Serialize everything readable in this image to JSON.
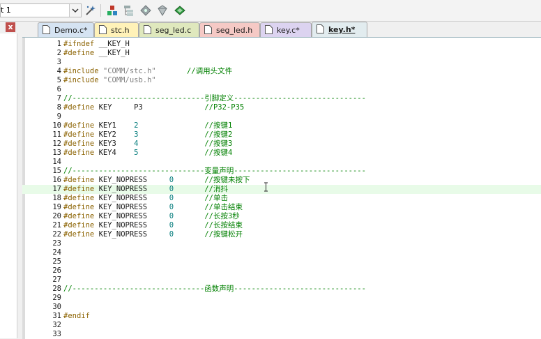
{
  "toolbar": {
    "target_value": "t 1",
    "icons": [
      "dropdown-arrow-icon",
      "magic-wand-icon",
      "component-icon",
      "hierarchy-icon",
      "diamond-icon",
      "options-icon",
      "books-icon"
    ]
  },
  "left_pane": {
    "close_label": "x"
  },
  "tabs": [
    {
      "label": "Demo.c*",
      "color": "#d5e3f2",
      "active": false
    },
    {
      "label": "stc.h",
      "color": "#fff2b8",
      "active": false
    },
    {
      "label": "seg_led.c",
      "color": "#dfe8bd",
      "active": false
    },
    {
      "label": "seg_led.h",
      "color": "#f5c9c5",
      "active": false
    },
    {
      "label": "key.c*",
      "color": "#dcd3f0",
      "active": false
    },
    {
      "label": "key.h*",
      "color": "#e2ecef",
      "active": true
    }
  ],
  "editor": {
    "highlight_line": 17,
    "lines": [
      {
        "n": "1",
        "seg": [
          {
            "c": "kw",
            "t": "#ifndef"
          },
          {
            "c": "",
            "t": " __KEY_H"
          }
        ]
      },
      {
        "n": "2",
        "seg": [
          {
            "c": "kw",
            "t": "#define"
          },
          {
            "c": "",
            "t": " __KEY_H"
          }
        ]
      },
      {
        "n": "3",
        "seg": []
      },
      {
        "n": "4",
        "seg": [
          {
            "c": "kw",
            "t": "#include"
          },
          {
            "c": "str",
            "t": " \"COMM/stc.h\""
          },
          {
            "c": "",
            "t": "       "
          },
          {
            "c": "cm",
            "t": "//调用头文件"
          }
        ]
      },
      {
        "n": "5",
        "seg": [
          {
            "c": "kw",
            "t": "#include"
          },
          {
            "c": "str",
            "t": " \"COMM/usb.h\""
          }
        ]
      },
      {
        "n": "6",
        "seg": []
      },
      {
        "n": "7",
        "seg": [
          {
            "c": "cm",
            "t": "//------------------------------引脚定义------------------------------"
          }
        ]
      },
      {
        "n": "8",
        "seg": [
          {
            "c": "kw",
            "t": "#define"
          },
          {
            "c": "",
            "t": " KEY     P3              "
          },
          {
            "c": "cm",
            "t": "//P32-P35"
          }
        ]
      },
      {
        "n": "9",
        "seg": []
      },
      {
        "n": "10",
        "seg": [
          {
            "c": "kw",
            "t": "#define"
          },
          {
            "c": "",
            "t": " KEY1    "
          },
          {
            "c": "num",
            "t": "2"
          },
          {
            "c": "",
            "t": "               "
          },
          {
            "c": "cm",
            "t": "//按键1"
          }
        ]
      },
      {
        "n": "11",
        "seg": [
          {
            "c": "kw",
            "t": "#define"
          },
          {
            "c": "",
            "t": " KEY2    "
          },
          {
            "c": "num",
            "t": "3"
          },
          {
            "c": "",
            "t": "               "
          },
          {
            "c": "cm",
            "t": "//按键2"
          }
        ]
      },
      {
        "n": "12",
        "seg": [
          {
            "c": "kw",
            "t": "#define"
          },
          {
            "c": "",
            "t": " KEY3    "
          },
          {
            "c": "num",
            "t": "4"
          },
          {
            "c": "",
            "t": "               "
          },
          {
            "c": "cm",
            "t": "//按键3"
          }
        ]
      },
      {
        "n": "13",
        "seg": [
          {
            "c": "kw",
            "t": "#define"
          },
          {
            "c": "",
            "t": " KEY4    "
          },
          {
            "c": "num",
            "t": "5"
          },
          {
            "c": "",
            "t": "               "
          },
          {
            "c": "cm",
            "t": "//按键4"
          }
        ]
      },
      {
        "n": "14",
        "seg": []
      },
      {
        "n": "15",
        "seg": [
          {
            "c": "cm",
            "t": "//------------------------------变量声明------------------------------"
          }
        ]
      },
      {
        "n": "16",
        "seg": [
          {
            "c": "kw",
            "t": "#define"
          },
          {
            "c": "",
            "t": " KEY_NOPRESS     "
          },
          {
            "c": "num",
            "t": "0"
          },
          {
            "c": "",
            "t": "       "
          },
          {
            "c": "cm",
            "t": "//按键未按下"
          }
        ]
      },
      {
        "n": "17",
        "seg": [
          {
            "c": "kw",
            "t": "#define"
          },
          {
            "c": "",
            "t": " KEY_NOPRESS     "
          },
          {
            "c": "num",
            "t": "0"
          },
          {
            "c": "",
            "t": "       "
          },
          {
            "c": "cm",
            "t": "//消抖"
          }
        ]
      },
      {
        "n": "18",
        "seg": [
          {
            "c": "kw",
            "t": "#define"
          },
          {
            "c": "",
            "t": " KEY_NOPRESS     "
          },
          {
            "c": "num",
            "t": "0"
          },
          {
            "c": "",
            "t": "       "
          },
          {
            "c": "cm",
            "t": "//单击"
          }
        ]
      },
      {
        "n": "19",
        "seg": [
          {
            "c": "kw",
            "t": "#define"
          },
          {
            "c": "",
            "t": " KEY_NOPRESS     "
          },
          {
            "c": "num",
            "t": "0"
          },
          {
            "c": "",
            "t": "       "
          },
          {
            "c": "cm",
            "t": "//单击结束"
          }
        ]
      },
      {
        "n": "20",
        "seg": [
          {
            "c": "kw",
            "t": "#define"
          },
          {
            "c": "",
            "t": " KEY_NOPRESS     "
          },
          {
            "c": "num",
            "t": "0"
          },
          {
            "c": "",
            "t": "       "
          },
          {
            "c": "cm",
            "t": "//长按3秒"
          }
        ]
      },
      {
        "n": "21",
        "seg": [
          {
            "c": "kw",
            "t": "#define"
          },
          {
            "c": "",
            "t": " KEY_NOPRESS     "
          },
          {
            "c": "num",
            "t": "0"
          },
          {
            "c": "",
            "t": "       "
          },
          {
            "c": "cm",
            "t": "//长按结束"
          }
        ]
      },
      {
        "n": "22",
        "seg": [
          {
            "c": "kw",
            "t": "#define"
          },
          {
            "c": "",
            "t": " KEY_NOPRESS     "
          },
          {
            "c": "num",
            "t": "0"
          },
          {
            "c": "",
            "t": "       "
          },
          {
            "c": "cm",
            "t": "//按键松开"
          }
        ]
      },
      {
        "n": "23",
        "seg": []
      },
      {
        "n": "24",
        "seg": []
      },
      {
        "n": "25",
        "seg": []
      },
      {
        "n": "26",
        "seg": []
      },
      {
        "n": "27",
        "seg": []
      },
      {
        "n": "28",
        "seg": [
          {
            "c": "cm",
            "t": "//------------------------------函数声明------------------------------"
          }
        ]
      },
      {
        "n": "29",
        "seg": []
      },
      {
        "n": "30",
        "seg": []
      },
      {
        "n": "31",
        "seg": [
          {
            "c": "kw",
            "t": "#endif"
          }
        ]
      },
      {
        "n": "32",
        "seg": []
      },
      {
        "n": "33",
        "seg": []
      }
    ]
  }
}
